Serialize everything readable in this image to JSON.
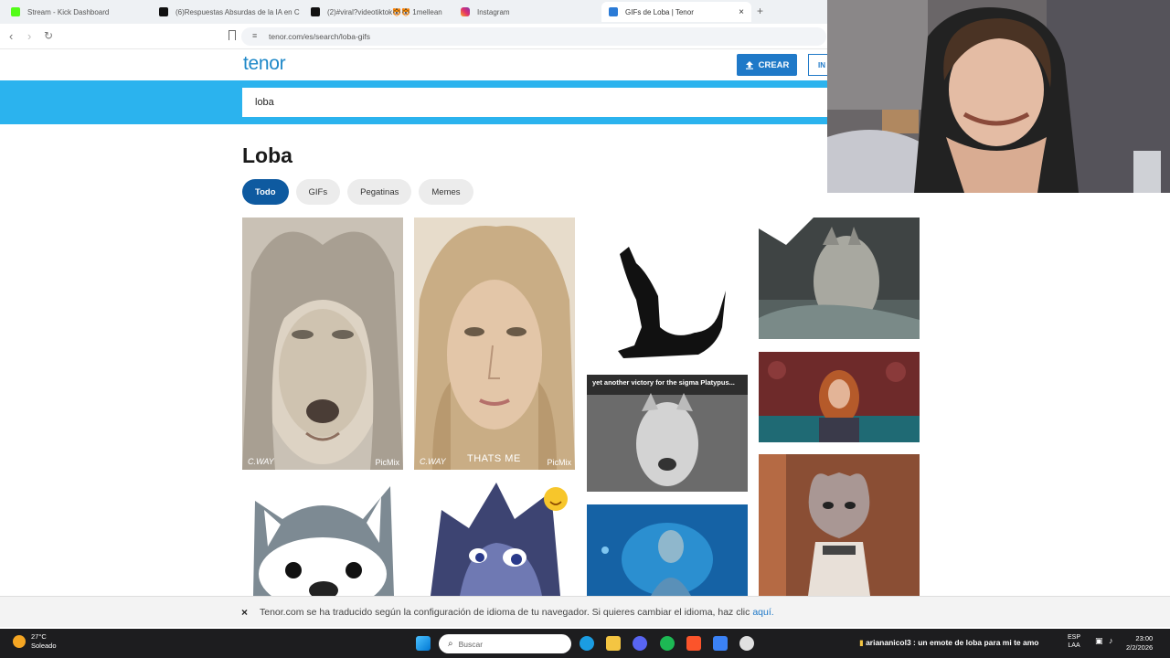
{
  "browser": {
    "tabs": [
      {
        "title": "Stream - Kick Dashboard",
        "color": "#53fc18",
        "active": false
      },
      {
        "title": "(6)Respuestas Absurdas de la IA en C",
        "color": "#111111",
        "active": false
      },
      {
        "title": "(2)#viral?videotiktok🐯🐯 1mellean",
        "color": "#111111",
        "active": false
      },
      {
        "title": "Instagram",
        "color": "#e1306c",
        "active": false
      },
      {
        "title": "GIFs de Loba | Tenor",
        "color": "#2b7bd6",
        "active": true
      }
    ],
    "new_tab": "+",
    "close_tab": "×",
    "url": "tenor.com/es/search/loba-gifs"
  },
  "tenor": {
    "logo": "tenor",
    "create_label": "CREAR",
    "login_label": "IN",
    "search_value": "loba",
    "page_title": "Loba",
    "filters": [
      "Todo",
      "GIFs",
      "Pegatinas",
      "Memes"
    ],
    "active_filter": "Todo"
  },
  "gifs": {
    "wm_picmix": "PicMix",
    "wm_ctext": "C.WAY",
    "thats_me": "THATS ME",
    "platypus_caption": "yet another victory for the sigma Platypus..."
  },
  "notice": {
    "close": "×",
    "text": "Tenor.com se ha traducido según la configuración de idioma de tu navegador. Si quieres cambiar el idioma, haz clic ",
    "link": "aquí."
  },
  "taskbar": {
    "temp": "27°C",
    "weather": "Soleado",
    "search_placeholder": "Buscar",
    "chat_user": "ariananicol3",
    "chat_message": " : un emote de loba para mi te amo",
    "lang_top": "ESP",
    "lang_bottom": "LAA",
    "time": "23:00",
    "date": "2/2/2026"
  }
}
